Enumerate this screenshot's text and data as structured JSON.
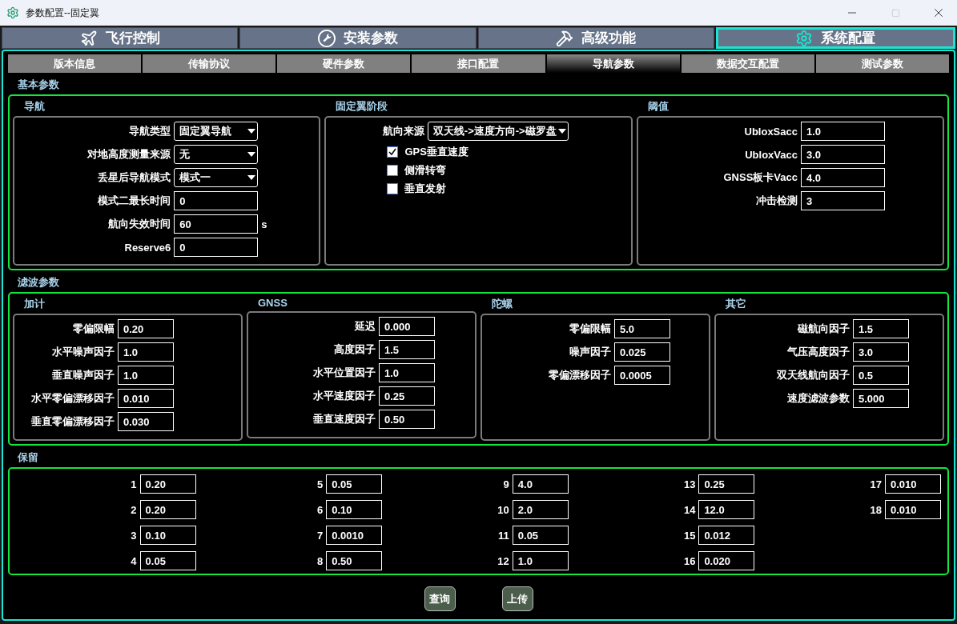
{
  "window": {
    "title": "参数配置--固定翼"
  },
  "main_tabs": [
    {
      "label": "飞行控制",
      "selected": false
    },
    {
      "label": "安装参数",
      "selected": false
    },
    {
      "label": "高级功能",
      "selected": false
    },
    {
      "label": "系统配置",
      "selected": true
    }
  ],
  "sub_tabs": [
    {
      "label": "版本信息",
      "selected": false
    },
    {
      "label": "传输协议",
      "selected": false
    },
    {
      "label": "硬件参数",
      "selected": false
    },
    {
      "label": "接口配置",
      "selected": false
    },
    {
      "label": "导航参数",
      "selected": true
    },
    {
      "label": "数据交互配置",
      "selected": false
    },
    {
      "label": "测试参数",
      "selected": false
    }
  ],
  "basic": {
    "title": "基本参数",
    "groups": [
      {
        "title": "导航",
        "rows": [
          {
            "kind": "select",
            "label": "导航类型",
            "value": "固定翼导航"
          },
          {
            "kind": "select",
            "label": "对地高度测量来源",
            "value": "无"
          },
          {
            "kind": "select",
            "label": "丢星后导航模式",
            "value": "模式一"
          },
          {
            "kind": "input",
            "label": "模式二最长时间",
            "value": "0"
          },
          {
            "kind": "input",
            "label": "航向失效时间",
            "value": "60",
            "unit": "s"
          },
          {
            "kind": "input",
            "label": "Reserve6",
            "value": "0"
          }
        ]
      },
      {
        "title": "固定翼阶段",
        "rows": [
          {
            "kind": "select",
            "label": "航向来源",
            "value": "双天线->速度方向->磁罗盘"
          },
          {
            "kind": "checkbox",
            "label": "GPS垂直速度",
            "checked": true
          },
          {
            "kind": "checkbox",
            "label": "侧滑转弯",
            "checked": false
          },
          {
            "kind": "checkbox",
            "label": "垂直发射",
            "checked": false
          }
        ]
      },
      {
        "title": "阈值",
        "rows": [
          {
            "kind": "input",
            "label": "UbloxSacc",
            "value": "1.0"
          },
          {
            "kind": "input",
            "label": "UbloxVacc",
            "value": "3.0"
          },
          {
            "kind": "input",
            "label": "GNSS板卡Vacc",
            "value": "4.0"
          },
          {
            "kind": "input",
            "label": "冲击检测",
            "value": "3"
          }
        ]
      }
    ]
  },
  "filter": {
    "title": "滤波参数",
    "groups": [
      {
        "title": "加计",
        "rows": [
          {
            "kind": "input",
            "label": "零偏限幅",
            "value": "0.20"
          },
          {
            "kind": "input",
            "label": "水平噪声因子",
            "value": "1.0"
          },
          {
            "kind": "input",
            "label": "垂直噪声因子",
            "value": "1.0"
          },
          {
            "kind": "input",
            "label": "水平零偏漂移因子",
            "value": "0.010"
          },
          {
            "kind": "input",
            "label": "垂直零偏漂移因子",
            "value": "0.030"
          }
        ]
      },
      {
        "title": "GNSS",
        "rows": [
          {
            "kind": "input",
            "label": "延迟",
            "value": "0.000"
          },
          {
            "kind": "input",
            "label": "高度因子",
            "value": "1.5"
          },
          {
            "kind": "input",
            "label": "水平位置因子",
            "value": "1.0"
          },
          {
            "kind": "input",
            "label": "水平速度因子",
            "value": "0.25"
          },
          {
            "kind": "input",
            "label": "垂直速度因子",
            "value": "0.50"
          }
        ]
      },
      {
        "title": "陀螺",
        "rows": [
          {
            "kind": "input",
            "label": "零偏限幅",
            "value": "5.0"
          },
          {
            "kind": "input",
            "label": "噪声因子",
            "value": "0.025"
          },
          {
            "kind": "input",
            "label": "零偏漂移因子",
            "value": "0.0005"
          }
        ]
      },
      {
        "title": "其它",
        "rows": [
          {
            "kind": "input",
            "label": "磁航向因子",
            "value": "1.5"
          },
          {
            "kind": "input",
            "label": "气压高度因子",
            "value": "3.0"
          },
          {
            "kind": "input",
            "label": "双天线航向因子",
            "value": "0.5"
          },
          {
            "kind": "input",
            "label": "速度滤波参数",
            "value": "5.000"
          }
        ]
      }
    ]
  },
  "reserve": {
    "title": "保留",
    "columns": [
      [
        {
          "label": "1",
          "value": "0.20"
        },
        {
          "label": "2",
          "value": "0.20"
        },
        {
          "label": "3",
          "value": "0.10"
        },
        {
          "label": "4",
          "value": "0.05"
        }
      ],
      [
        {
          "label": "5",
          "value": "0.05"
        },
        {
          "label": "6",
          "value": "0.10"
        },
        {
          "label": "7",
          "value": "0.0010"
        },
        {
          "label": "8",
          "value": "0.50"
        }
      ],
      [
        {
          "label": "9",
          "value": "4.0"
        },
        {
          "label": "10",
          "value": "2.0"
        },
        {
          "label": "11",
          "value": "0.05"
        },
        {
          "label": "12",
          "value": "1.0"
        }
      ],
      [
        {
          "label": "13",
          "value": "0.25"
        },
        {
          "label": "14",
          "value": "12.0"
        },
        {
          "label": "15",
          "value": "0.012"
        },
        {
          "label": "16",
          "value": "0.020"
        }
      ],
      [
        {
          "label": "17",
          "value": "0.010"
        },
        {
          "label": "18",
          "value": "0.010"
        }
      ]
    ]
  },
  "buttons": [
    "查询",
    "上传"
  ]
}
